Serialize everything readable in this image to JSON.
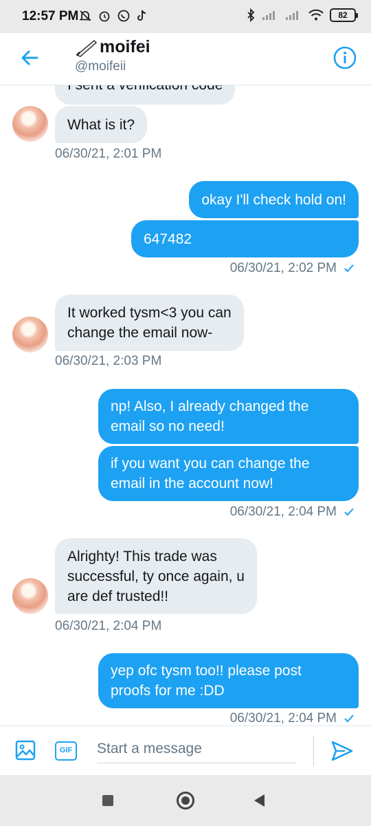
{
  "status_bar": {
    "time": "12:57 PM",
    "battery": "82"
  },
  "header": {
    "name": "moifei",
    "handle": "@moifeii"
  },
  "messages": [
    {
      "direction": "in",
      "text": "I sent a verification code"
    },
    {
      "direction": "in",
      "text": "What is it?"
    },
    {
      "direction": "in",
      "text": "06/30/21, 2:01 PM",
      "kind": "timestamp"
    },
    {
      "direction": "out",
      "text": "okay I'll check hold on!"
    },
    {
      "direction": "out",
      "text": "647482"
    },
    {
      "direction": "out",
      "text": "06/30/21, 2:02 PM",
      "kind": "timestamp"
    },
    {
      "direction": "in",
      "lines": [
        "It worked tysm<3 you can",
        "change the email now-"
      ]
    },
    {
      "direction": "in",
      "text": "06/30/21, 2:03 PM",
      "kind": "timestamp"
    },
    {
      "direction": "out",
      "lines": [
        "np! Also, I already changed the",
        "email so no need!"
      ]
    },
    {
      "direction": "out",
      "lines": [
        "if you want you can change the",
        "email in the account now!"
      ]
    },
    {
      "direction": "out",
      "text": "06/30/21, 2:04 PM",
      "kind": "timestamp"
    },
    {
      "direction": "in",
      "lines": [
        "Alrighty! This trade was",
        "successful, ty once again, u",
        "are def trusted!!"
      ]
    },
    {
      "direction": "in",
      "text": "06/30/21, 2:04 PM",
      "kind": "timestamp"
    },
    {
      "direction": "out",
      "lines": [
        "yep ofc tysm too!! please post",
        "proofs for me :DD"
      ]
    },
    {
      "direction": "out",
      "text": "06/30/21, 2:04 PM",
      "kind": "timestamp"
    }
  ],
  "composer": {
    "placeholder": "Start a message",
    "gif_label": "GIF"
  },
  "colors": {
    "accent": "#1da1f2",
    "incoming_bubble": "#e6ecf0",
    "timestamp": "#657786"
  },
  "icons": [
    "back-arrow-icon",
    "quill-pen-icon",
    "info-icon",
    "image-icon",
    "gif-icon",
    "send-icon",
    "read-check-icon"
  ]
}
